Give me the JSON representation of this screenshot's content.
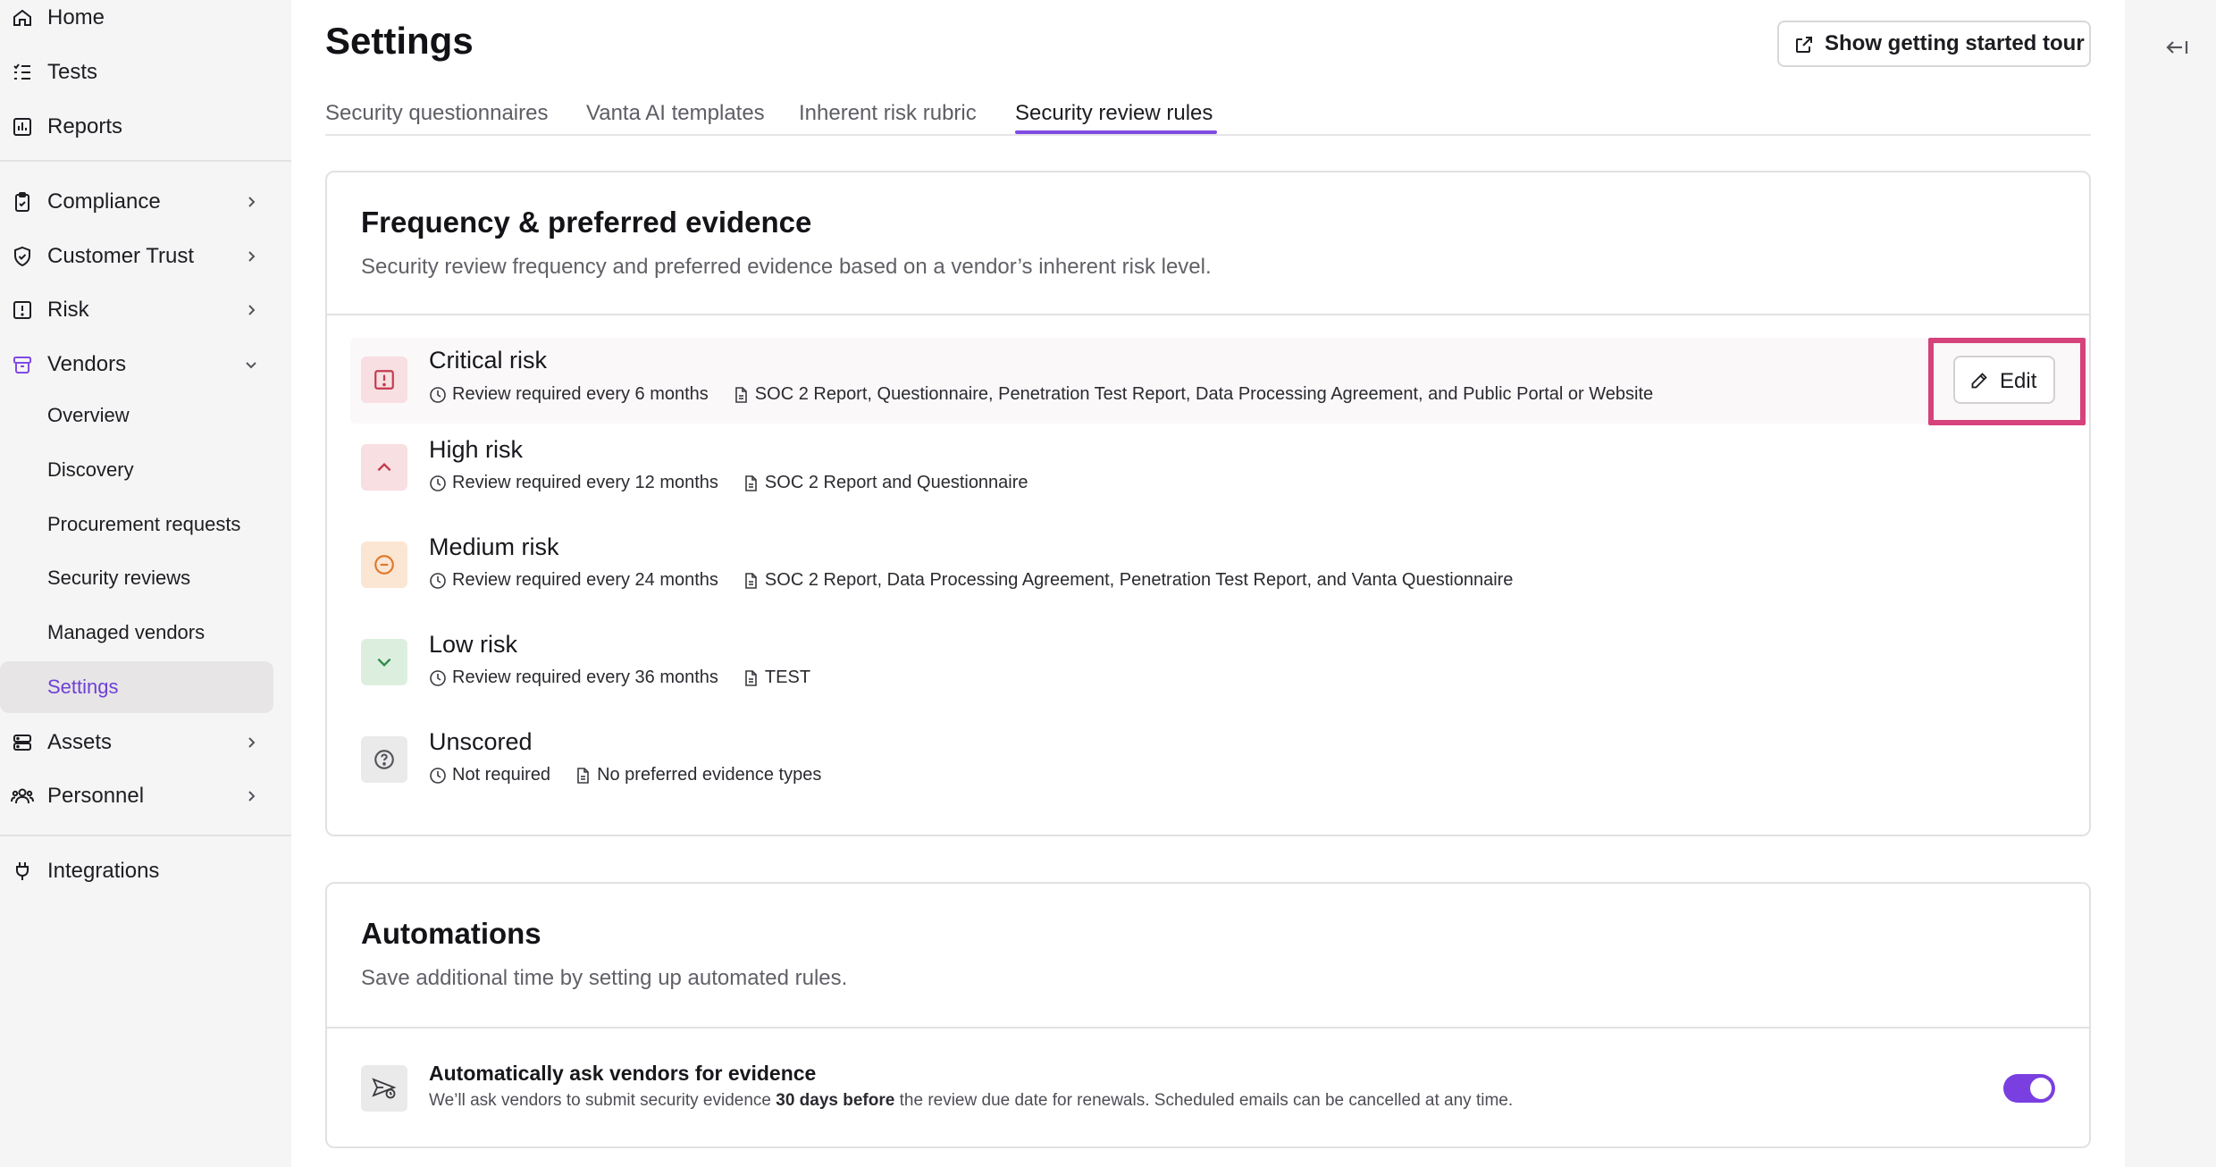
{
  "sidebar": {
    "items": [
      {
        "label": "Home",
        "icon": "home-icon"
      },
      {
        "label": "Tests",
        "icon": "list-check-icon"
      },
      {
        "label": "Reports",
        "icon": "bar-chart-icon"
      },
      {
        "label": "Compliance",
        "icon": "clipboard-check-icon"
      },
      {
        "label": "Customer Trust",
        "icon": "shield-check-icon"
      },
      {
        "label": "Risk",
        "icon": "alert-square-icon"
      },
      {
        "label": "Vendors",
        "icon": "vendors-icon",
        "color": "#7f4be3"
      },
      {
        "label": "Assets",
        "icon": "server-icon"
      },
      {
        "label": "Personnel",
        "icon": "people-icon"
      },
      {
        "label": "Integrations",
        "icon": "plug-icon"
      }
    ],
    "vendor_subitems": [
      "Overview",
      "Discovery",
      "Procurement requests",
      "Security reviews",
      "Managed vendors",
      "Settings"
    ]
  },
  "header": {
    "title": "Settings",
    "tour_button": "Show getting started tour"
  },
  "tabs": [
    "Security questionnaires",
    "Vanta AI templates",
    "Inherent risk rubric",
    "Security review rules"
  ],
  "frequency": {
    "title": "Frequency & preferred evidence",
    "description": "Security review frequency and preferred evidence based on a vendor’s inherent risk level.",
    "edit_label": "Edit",
    "rows": [
      {
        "name": "Critical risk",
        "review": "Review required every 6 months",
        "evidence": "SOC 2 Report, Questionnaire, Penetration Test Report, Data Processing Agreement, and Public Portal or Website",
        "icon": "alert-square-icon",
        "color": "#c43a4d"
      },
      {
        "name": "High risk",
        "review": "Review required every 12 months",
        "evidence": "SOC 2 Report and Questionnaire",
        "icon": "chevron-up-icon",
        "color": "#c43a4d"
      },
      {
        "name": "Medium risk",
        "review": "Review required every 24 months",
        "evidence": "SOC 2 Report, Data Processing Agreement, Penetration Test Report, and Vanta Questionnaire",
        "icon": "minus-circle-icon",
        "color": "#e0782a"
      },
      {
        "name": "Low risk",
        "review": "Review required every 36 months",
        "evidence": "TEST",
        "icon": "chevron-down-icon",
        "color": "#2f8a46"
      },
      {
        "name": "Unscored",
        "review": "Not required",
        "evidence": "No preferred evidence types",
        "icon": "question-circle-icon",
        "color": "#55545b"
      }
    ]
  },
  "automations": {
    "title": "Automations",
    "description": "Save additional time by setting up automated rules.",
    "rule": {
      "title": "Automatically ask vendors for evidence",
      "desc_before": "We’ll ask vendors to submit security evidence ",
      "desc_bold": "30 days before",
      "desc_after": " the review due date for renewals. Scheduled emails can be cancelled at any time.",
      "enabled": true
    }
  }
}
